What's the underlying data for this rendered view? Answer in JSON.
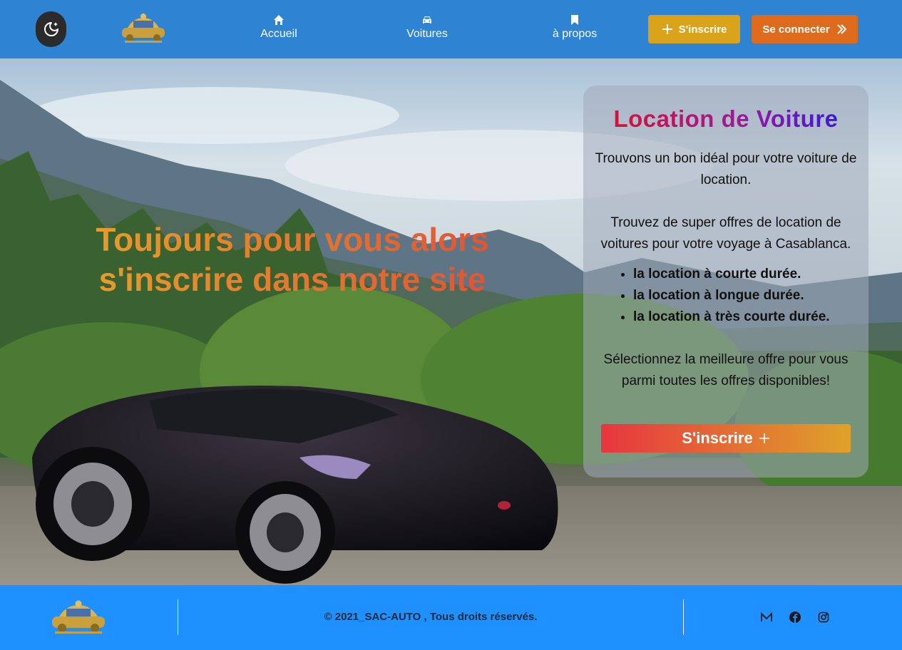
{
  "navbar": {
    "links": [
      {
        "label": "Accueil",
        "icon": "home-icon"
      },
      {
        "label": "Voitures",
        "icon": "car-icon"
      },
      {
        "label": "à propos",
        "icon": "bookmark-icon"
      }
    ],
    "signup_label": "S'inscrire",
    "login_label": "Se connecter",
    "logo_alt": "SAC-AUTO"
  },
  "hero": {
    "headline": "Toujours pour vous alors s'inscrire dans notre site"
  },
  "card": {
    "title": "Location de Voiture",
    "p1": "Trouvons un bon idéal pour votre voiture de location.",
    "p2": "Trouvez de super offres de location de voitures pour votre voyage à Casablanca.",
    "features": [
      "la location à courte durée.",
      "la location à longue durée.",
      "la location à très courte durée."
    ],
    "p3": "Sélectionnez la meilleure offre pour vous parmi toutes les offres disponibles!",
    "button_label": "S'inscrire"
  },
  "footer": {
    "copyright": "© 2021_SAC-AUTO , Tous droits réservés.",
    "social": [
      "mail-icon",
      "facebook-icon",
      "instagram-icon"
    ]
  },
  "colors": {
    "navbar_bg": "#2f83d3",
    "footer_bg": "#1e90ff",
    "signup_btn": "#dba31a",
    "login_btn": "#de6b1c"
  }
}
